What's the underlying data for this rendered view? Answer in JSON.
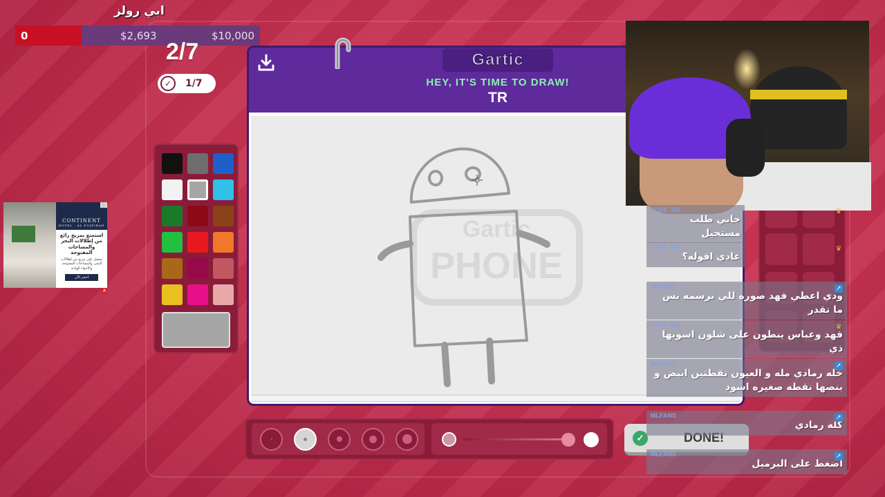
{
  "streamer": {
    "name": "ابي رولز"
  },
  "goal": {
    "start": "0",
    "current": "$2,693",
    "target": "$10,000",
    "progress": 0.27
  },
  "round": {
    "counter": "2/7",
    "done_count": "1/7"
  },
  "ad": {
    "brand": "CONTINENT",
    "brand_sub": "HOTEL · AL FUJEIRAH",
    "headline": "استمتع بمزيج رائع من إطلالات البحر والمساحات المفتوحة",
    "body": "تحصل على مزيج من إطلالات البحر، والمساحات المفتوحة، والأجواء الهادئة",
    "cta": "احجز الآن",
    "badge": "A"
  },
  "palette": {
    "colors": [
      "#111111",
      "#6e6e6e",
      "#1e5fc8",
      "#f2f2f2",
      "#a6a6a6",
      "#30c0e8",
      "#1a7a28",
      "#8c0a18",
      "#8c4218",
      "#22c040",
      "#e81a20",
      "#f07828",
      "#a8681a",
      "#960a4a",
      "#c05860",
      "#e8c020",
      "#e8108a",
      "#e8a8a8"
    ],
    "selected_index": 4,
    "current_color": "#a6a6a6"
  },
  "game": {
    "logo": "Gartic",
    "prompt": "HEY, IT'S TIME TO DRAW!",
    "word": "TR",
    "watermark_top": "Gartic",
    "watermark_bottom": "PHONE",
    "done_label": "DONE!"
  },
  "brush": {
    "sizes": [
      1,
      2,
      3,
      4,
      5
    ],
    "selected_size_index": 1
  },
  "chat": [
    {
      "user": "LOVE_ND",
      "text": "جاني طلب مستحيل",
      "badge": "crown",
      "wide": false
    },
    {
      "user": "LOVE_ND",
      "text": "عادي اقوله؟",
      "badge": "crown",
      "wide": false
    },
    {
      "user": "MLFANS",
      "text": "ودي اعطي فهد صوره للي نرسمه بس ما تقدر",
      "badge": "sub",
      "wide": true
    },
    {
      "user": "LOVE_ND",
      "text": "فهد وعباس ينطون على شلون اسويها ذي",
      "badge": "crown",
      "wide": true
    },
    {
      "user": "MLFANS",
      "text": "خله رمادي مله و العيون نقطتين ابيض و بنصها نقطه صغيره اسود",
      "badge": "sub",
      "wide": true
    },
    {
      "user": "MLFANS",
      "text": "كله رمادي",
      "badge": "sub",
      "wide": true
    },
    {
      "user": "MLFANS",
      "text": "اضغط على البرميل",
      "badge": "sub",
      "wide": true
    }
  ]
}
